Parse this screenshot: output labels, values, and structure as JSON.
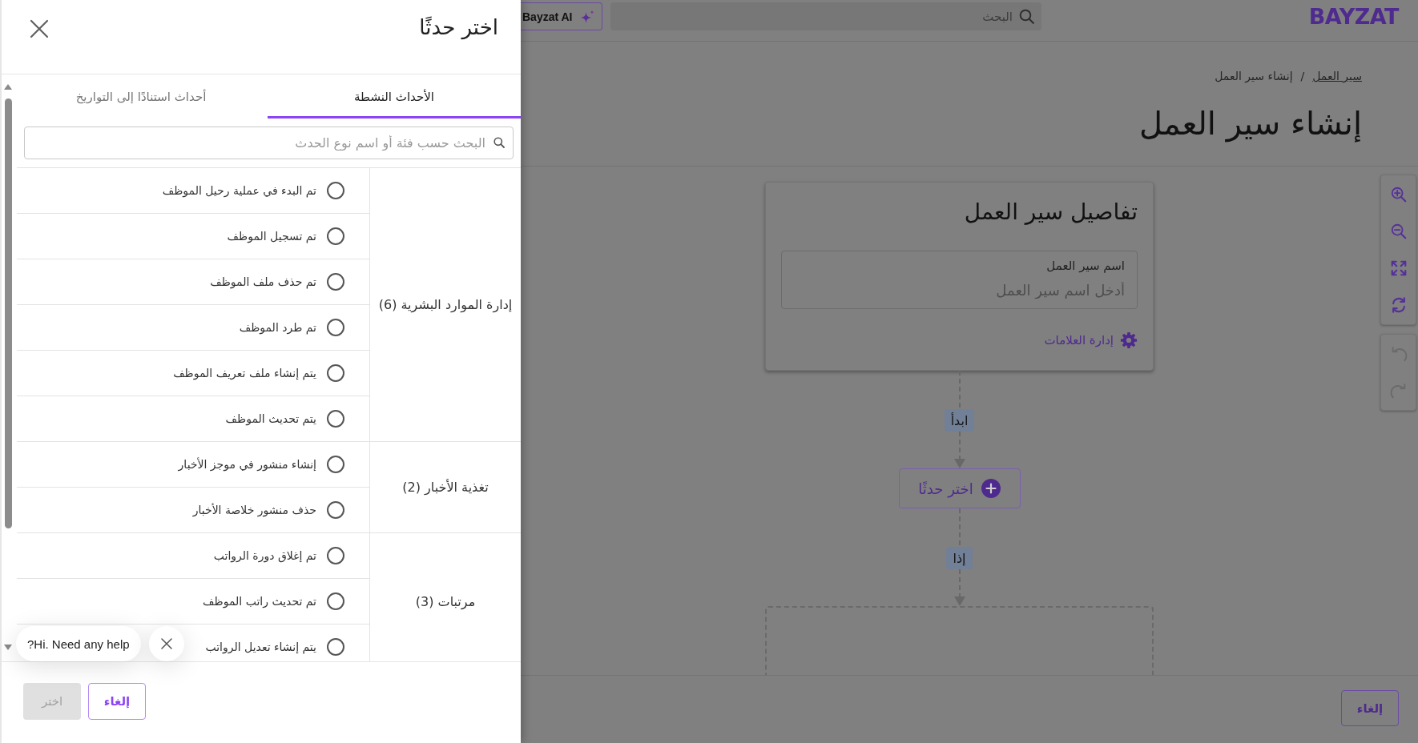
{
  "drawer": {
    "title": "اختر حدثًا",
    "tabs": [
      {
        "label": "الأحداث النشطة",
        "selected": true
      },
      {
        "label": "أحداث استنادًا إلى التواريخ",
        "selected": false
      }
    ],
    "search": {
      "placeholder": "البحث حسب فئة أو اسم نوع الحدث"
    },
    "groups": [
      {
        "category": "إدارة الموارد البشرية (6)",
        "events": [
          {
            "label": "تم البدء في عملية رحيل الموظف",
            "selected": false
          },
          {
            "label": "تم تسجيل الموظف",
            "selected": false
          },
          {
            "label": "تم حذف ملف الموظف",
            "selected": false
          },
          {
            "label": "تم طرد الموظف",
            "selected": false
          },
          {
            "label": "يتم إنشاء ملف تعريف الموظف",
            "selected": false
          },
          {
            "label": "يتم تحديث الموظف",
            "selected": false
          }
        ]
      },
      {
        "category": "تغذية الأخبار (2)",
        "events": [
          {
            "label": "إنشاء منشور في موجز الأخبار",
            "selected": false
          },
          {
            "label": "حذف منشور خلاصة الأخبار",
            "selected": false
          }
        ]
      },
      {
        "category": "مرتبات (3)",
        "events": [
          {
            "label": "تم إغلاق دورة الرواتب",
            "selected": false
          },
          {
            "label": "تم تحديث راتب الموظف",
            "selected": false
          },
          {
            "label": "يتم إنشاء تعديل الرواتب",
            "selected": false
          }
        ]
      }
    ],
    "buttons": [
      {
        "label": "إلغاء",
        "kind": "outlined",
        "disabled": false
      },
      {
        "label": "اختر",
        "kind": "filled",
        "disabled": true
      }
    ]
  },
  "chat_prompt": {
    "text": "?Hi. Need any help"
  },
  "page": {
    "logo": "BAYZAT",
    "search": {
      "placeholder": "البحث"
    },
    "ai_button": {
      "label": "Bayzat AI"
    },
    "breadcrumb": [
      {
        "label": "سير العمل",
        "link": true
      },
      {
        "label": "إنشاء سير العمل",
        "link": false
      }
    ],
    "breadcrumb_separator": "/",
    "title": "إنشاء سير العمل",
    "details_card": {
      "title": "تفاصيل سير العمل",
      "field": {
        "label": "اسم سير العمل",
        "placeholder": "أدخل اسم سير العمل"
      },
      "link": "إدارة العلامات"
    },
    "flow": [
      {
        "kind": "tag",
        "label": "ابدأ"
      },
      {
        "kind": "action_button",
        "label": "اختر حدثًا"
      },
      {
        "kind": "tag",
        "label": "إذا"
      },
      {
        "kind": "drop_zone"
      }
    ],
    "toolbar": [
      {
        "tools": [
          {
            "disabled": false
          },
          {
            "disabled": false
          },
          {
            "disabled": false
          },
          {
            "disabled": false
          }
        ]
      },
      {
        "tools": [
          {
            "disabled": true
          },
          {
            "disabled": true
          }
        ]
      }
    ],
    "footer": {
      "cancel_button": "إلغاء"
    }
  }
}
